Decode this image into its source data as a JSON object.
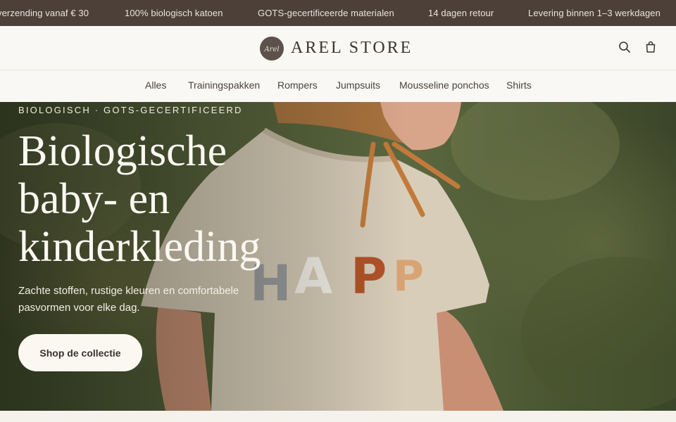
{
  "announcement": {
    "messages": [
      "verzending vanaf € 30",
      "100% biologisch katoen",
      "GOTS-gecertificeerde materialen",
      "14 dagen retour",
      "Levering binnen 1–3 werkdagen"
    ]
  },
  "header": {
    "brand": "AREL STORE",
    "logo_script": "Arel",
    "icons": [
      "search-icon",
      "shopping-bag-icon"
    ]
  },
  "nav": {
    "items": [
      "Alles",
      "Trainingspakken",
      "Rompers",
      "Jumpsuits",
      "Mousseline ponchos",
      "Shirts"
    ]
  },
  "hero": {
    "eyebrow": "BIOLOGISCH · GOTS-GECERTIFICEERD",
    "title_lines": [
      "Biologische",
      "baby- en",
      "kinderkleding"
    ],
    "subtitle": "Zachte stoffen, rustige kleuren en comfortabele pasvormen voor elke dag.",
    "cta_label": "Shop de collectie",
    "shirt_text": "HAPP"
  },
  "colors": {
    "announcement_bg": "#4d4039",
    "header_bg": "#faf8f4",
    "accent_text": "#3a322c",
    "cta_bg": "#fbf8f2"
  }
}
